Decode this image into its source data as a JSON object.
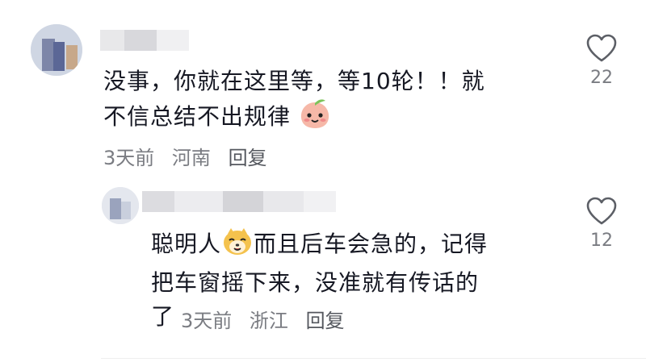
{
  "comments": [
    {
      "text_part1": "没事，你就在这里等，等10轮！！就",
      "text_part2": "不信总结不出规律",
      "emoji": "peach-face-emoji",
      "time": "3天前",
      "location": "河南",
      "reply_label": "回复",
      "likes": "22"
    },
    {
      "text_part1": "聪明人",
      "emoji": "smiling-fox-emoji",
      "text_part1b": "而且后车会急的，记得",
      "text_part2": "把车窗摇下来，没准就有传话的",
      "text_part3": "了",
      "time": "3天前",
      "location": "浙江",
      "reply_label": "回复",
      "likes": "12"
    }
  ],
  "colors": {
    "text": "#161823",
    "meta": "#7a7c82",
    "icon": "#5c5f66"
  }
}
